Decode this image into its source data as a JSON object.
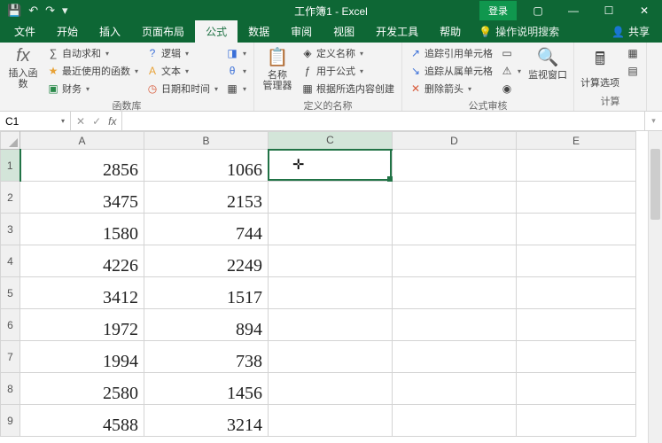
{
  "titlebar": {
    "title": "工作簿1 - Excel",
    "login": "登录",
    "qat_save": "💾",
    "qat_undo": "↶",
    "qat_redo": "↷",
    "qat_more": "▾"
  },
  "tabs": {
    "file": "文件",
    "home": "开始",
    "insert": "插入",
    "layout": "页面布局",
    "formulas": "公式",
    "data": "数据",
    "review": "审阅",
    "view": "视图",
    "dev": "开发工具",
    "help": "帮助",
    "tell": "操作说明搜索",
    "share": "共享"
  },
  "ribbon": {
    "insert_fn": "插入函数",
    "autosum": "自动求和",
    "recent": "最近使用的函数",
    "financial": "财务",
    "logical": "逻辑",
    "text": "文本",
    "datetime": "日期和时间",
    "lookup": "",
    "math": "",
    "more_fn": "",
    "group_fnlib": "函数库",
    "name_mgr": "名称\n管理器",
    "define_name": "定义名称",
    "use_in_formula": "用于公式",
    "create_from_sel": "根据所选内容创建",
    "group_names": "定义的名称",
    "trace_prec": "追踪引用单元格",
    "trace_dep": "追踪从属单元格",
    "remove_arrows": "删除箭头",
    "group_audit": "公式审核",
    "watch": "监视窗口",
    "calc_opts": "计算选项",
    "group_calc": "计算"
  },
  "formula_bar": {
    "name": "C1",
    "value": ""
  },
  "columns": [
    "A",
    "B",
    "C",
    "D",
    "E"
  ],
  "rows": [
    {
      "n": 1,
      "A": "2856",
      "B": "1066"
    },
    {
      "n": 2,
      "A": "3475",
      "B": "2153"
    },
    {
      "n": 3,
      "A": "1580",
      "B": "744"
    },
    {
      "n": 4,
      "A": "4226",
      "B": "2249"
    },
    {
      "n": 5,
      "A": "3412",
      "B": "1517"
    },
    {
      "n": 6,
      "A": "1972",
      "B": "894"
    },
    {
      "n": 7,
      "A": "1994",
      "B": "738"
    },
    {
      "n": 8,
      "A": "2580",
      "B": "1456"
    },
    {
      "n": 9,
      "A": "4588",
      "B": "3214"
    }
  ],
  "selected_cell": "C1"
}
